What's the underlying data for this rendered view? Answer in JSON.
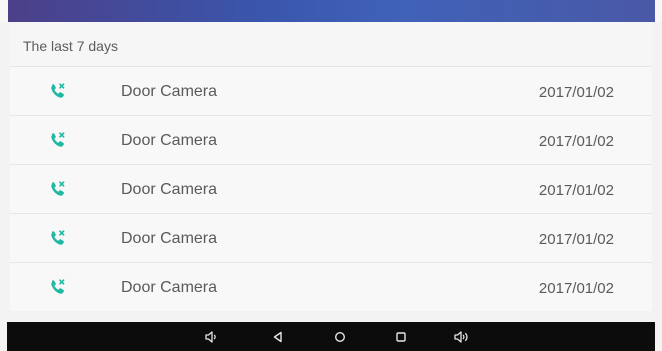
{
  "section": {
    "title": "The last 7 days"
  },
  "calls": [
    {
      "name": "Door Camera",
      "date": "2017/01/02",
      "icon": "missed-call-icon"
    },
    {
      "name": "Door Camera",
      "date": "2017/01/02",
      "icon": "missed-call-icon"
    },
    {
      "name": "Door Camera",
      "date": "2017/01/02",
      "icon": "missed-call-icon"
    },
    {
      "name": "Door Camera",
      "date": "2017/01/02",
      "icon": "missed-call-icon"
    },
    {
      "name": "Door Camera",
      "date": "2017/01/02",
      "icon": "missed-call-icon"
    }
  ],
  "nav": {
    "buttons": [
      "volume-down-icon",
      "back-icon",
      "home-icon",
      "recents-icon",
      "volume-up-icon"
    ]
  },
  "colors": {
    "accent": "#1fb8a2",
    "header_start": "#4c3f88",
    "header_end": "#3f62b8",
    "nav_bar": "#0c0c0c"
  }
}
